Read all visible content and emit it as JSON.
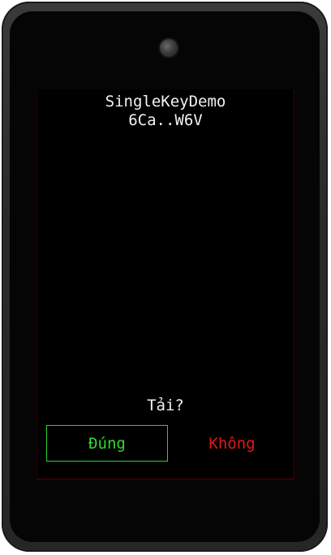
{
  "app": {
    "title": "SingleKeyDemo",
    "subtitle": "6Ca..W6V"
  },
  "dialog": {
    "prompt": "Tải?",
    "yes_label": "Đúng",
    "no_label": "Không"
  },
  "colors": {
    "yes": "#34d934",
    "no": "#e01919",
    "text": "#f2f2f2",
    "screen": "#000000"
  },
  "icons": {
    "camera": "camera-lens-icon"
  }
}
